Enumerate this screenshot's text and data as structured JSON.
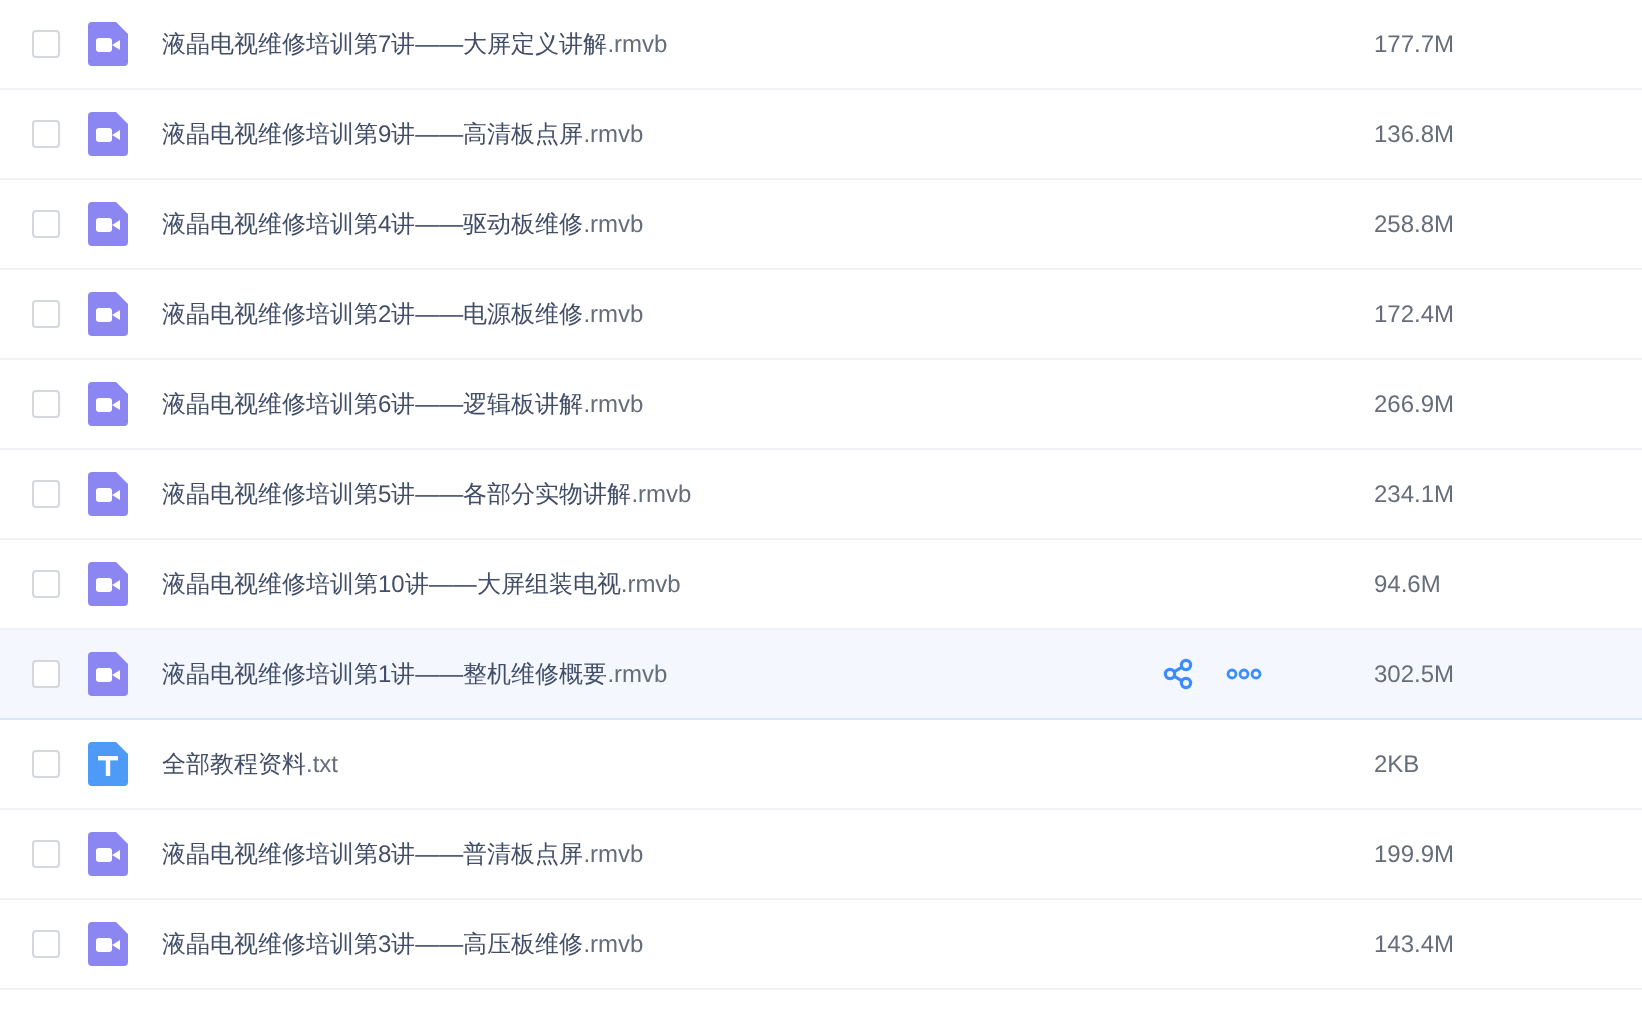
{
  "files": [
    {
      "kind": "video",
      "name": "液晶电视维修培训第7讲——大屏定义讲解",
      "ext": ".rmvb",
      "size": "177.7M",
      "checked": false,
      "highlighted": false
    },
    {
      "kind": "video",
      "name": "液晶电视维修培训第9讲——高清板点屏",
      "ext": ".rmvb",
      "size": "136.8M",
      "checked": false,
      "highlighted": false
    },
    {
      "kind": "video",
      "name": "液晶电视维修培训第4讲——驱动板维修",
      "ext": ".rmvb",
      "size": "258.8M",
      "checked": false,
      "highlighted": false
    },
    {
      "kind": "video",
      "name": "液晶电视维修培训第2讲——电源板维修",
      "ext": ".rmvb",
      "size": "172.4M",
      "checked": false,
      "highlighted": false
    },
    {
      "kind": "video",
      "name": "液晶电视维修培训第6讲——逻辑板讲解",
      "ext": ".rmvb",
      "size": "266.9M",
      "checked": false,
      "highlighted": false
    },
    {
      "kind": "video",
      "name": "液晶电视维修培训第5讲——各部分实物讲解",
      "ext": ".rmvb",
      "size": "234.1M",
      "checked": false,
      "highlighted": false
    },
    {
      "kind": "video",
      "name": "液晶电视维修培训第10讲——大屏组装电视",
      "ext": ".rmvb",
      "size": "94.6M",
      "checked": false,
      "highlighted": false
    },
    {
      "kind": "video",
      "name": "液晶电视维修培训第1讲——整机维修概要",
      "ext": ".rmvb",
      "size": "302.5M",
      "checked": false,
      "highlighted": true
    },
    {
      "kind": "text",
      "name": "全部教程资料",
      "ext": ".txt",
      "size": "2KB",
      "checked": false,
      "highlighted": false
    },
    {
      "kind": "video",
      "name": "液晶电视维修培训第8讲——普清板点屏",
      "ext": ".rmvb",
      "size": "199.9M",
      "checked": false,
      "highlighted": false
    },
    {
      "kind": "video",
      "name": "液晶电视维修培训第3讲——高压板维修",
      "ext": ".rmvb",
      "size": "143.4M",
      "checked": false,
      "highlighted": false
    }
  ]
}
